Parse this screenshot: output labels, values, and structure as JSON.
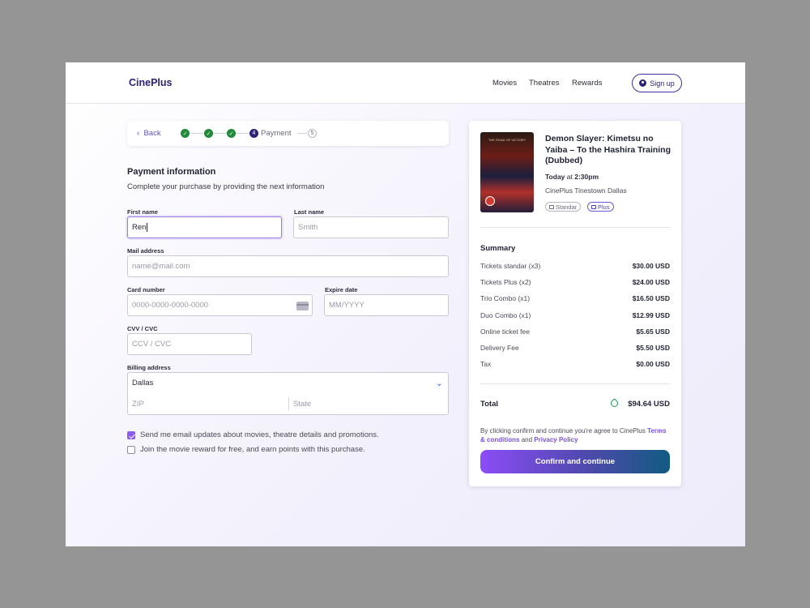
{
  "header": {
    "logo": "CinePlus",
    "nav": [
      "Movies",
      "Theatres",
      "Rewards"
    ],
    "signup_label": "Sign up"
  },
  "stepper": {
    "back_label": "Back",
    "current_step_number": "4",
    "current_step_label": "Payment",
    "next_step_number": "5",
    "completed_steps": 3
  },
  "form": {
    "title": "Payment information",
    "subtitle": "Complete your purchase by providing the next information",
    "first_name": {
      "label": "First name",
      "value": "Ren"
    },
    "last_name": {
      "label": "Last name",
      "placeholder": "Smith"
    },
    "mail": {
      "label": "Mail address",
      "placeholder": "name@mail.com"
    },
    "card_number": {
      "label": "Card number",
      "placeholder": "0000-0000-0000-0000"
    },
    "expire": {
      "label": "Expire date",
      "placeholder": "MM/YYYY"
    },
    "cvv": {
      "label": "CVV / CVC",
      "placeholder": "CCV / CVC"
    },
    "billing": {
      "label": "Billing address",
      "city": "Dallas",
      "zip_placeholder": "ZIP",
      "state_placeholder": "State"
    },
    "checkboxes": [
      {
        "label": "Send me email updates about movies, theatre details and promotions.",
        "checked": true
      },
      {
        "label": "Join the movie reward for free, and earn points with this purchase.",
        "checked": false
      }
    ]
  },
  "order": {
    "movie_title": "Demon Slayer: Kimetsu no Yaiba – To the Hashira Training (Dubbed)",
    "poster_text": "THE ROAD OF VICTORY",
    "day": "Today",
    "at": "at",
    "time": "2:30pm",
    "location": "CinePlus Tinestown Dallas",
    "tags": [
      "Standar",
      "Plus"
    ],
    "summary_title": "Summary",
    "items": [
      {
        "label": "Tickets standar (x3)",
        "amount": "$30.00 USD"
      },
      {
        "label": "Tickets Plus (x2)",
        "amount": "$24.00 USD"
      },
      {
        "label": "Trio Combo (x1)",
        "amount": "$16.50 USD"
      },
      {
        "label": "Duo Combo (x1)",
        "amount": "$12.99 USD"
      },
      {
        "label": "Online ticket fee",
        "amount": "$5.65 USD"
      },
      {
        "label": "Delivery Fee",
        "amount": "$5.50 USD"
      },
      {
        "label": "Tax",
        "amount": "$0.00 USD"
      }
    ],
    "total_label": "Total",
    "total_amount": "$94.64 USD",
    "terms_prefix": "By clicking confirm and continue you're agree to CinePlus",
    "terms_link": "Terms & conditions",
    "terms_and": "and",
    "privacy_link": "Privacy Policy",
    "confirm_label": "Confirm and continue"
  },
  "colors": {
    "brand": "#2a2277",
    "accent": "#8c4cf7",
    "success": "#1e8a3a"
  }
}
